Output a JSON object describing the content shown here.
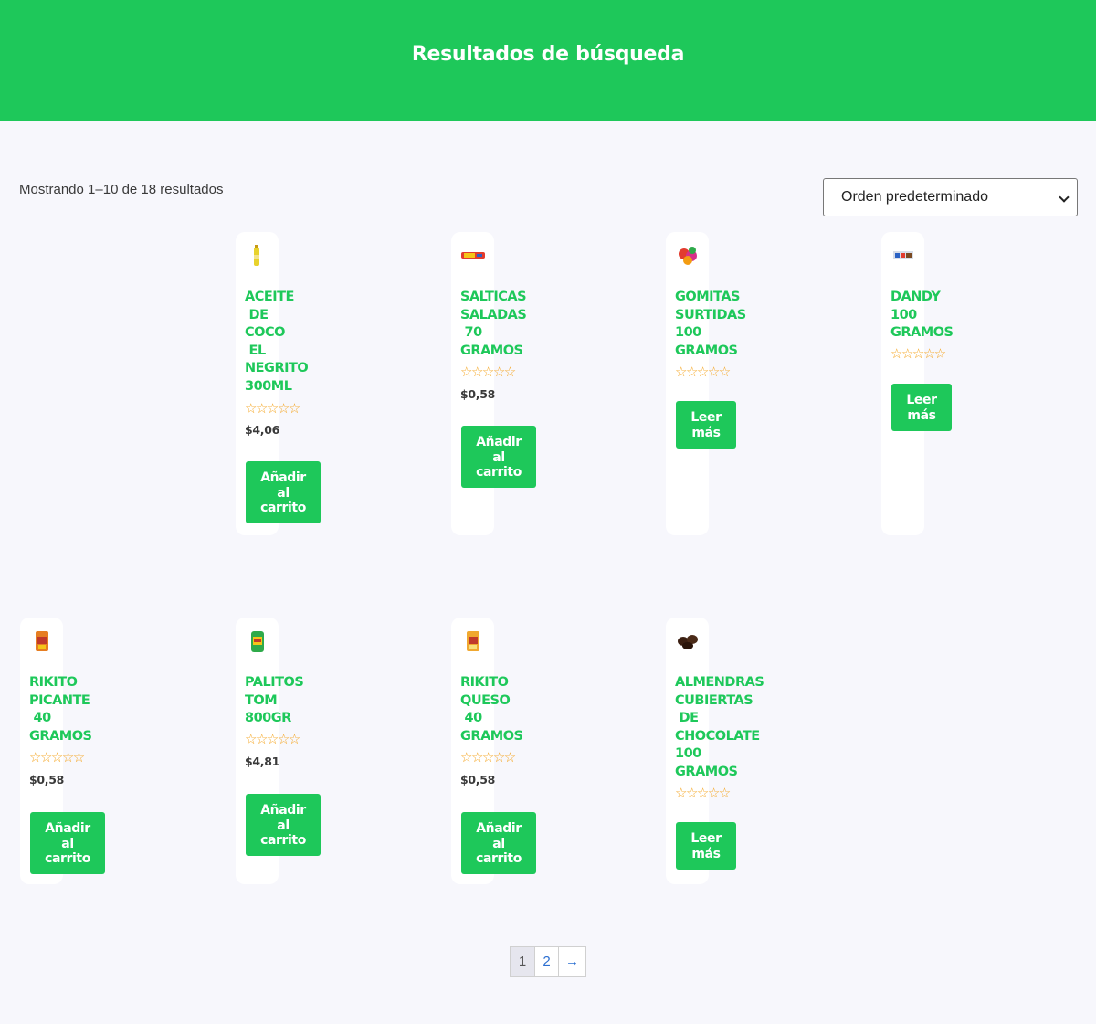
{
  "header": {
    "title": "Resultados de búsqueda"
  },
  "toolbar": {
    "result_count": "Mostrando 1–10 de 18 resultados",
    "orderby_selected": "Orden predeterminado"
  },
  "products": [
    {
      "name": "ACEITE\n DE\nCOCO\n EL\nNEGRITO\n300ML",
      "rating": "☆☆☆☆☆",
      "price": "$4,06",
      "button": "Añadir\nal\ncarrito"
    },
    {
      "name": "SALTICAS\nSALADAS\n 70\nGRAMOS",
      "rating": "☆☆☆☆☆",
      "price": "$0,58",
      "button": "Añadir\nal\ncarrito"
    },
    {
      "name": "GOMITAS\nSURTIDAS\n100\nGRAMOS",
      "rating": "☆☆☆☆☆",
      "button": "Leer\nmás"
    },
    {
      "name": "DANDY\n100\nGRAMOS",
      "rating": "☆☆☆☆☆",
      "button": "Leer\nmás"
    },
    {
      "name": "RIKITO\nPICANTE\n 40\nGRAMOS",
      "rating": "☆☆☆☆☆",
      "price": "$0,58",
      "button": "Añadir\nal\ncarrito"
    },
    {
      "name": "PALITOS\nTOM\n800GR",
      "rating": "☆☆☆☆☆",
      "price": "$4,81",
      "button": "Añadir\nal\ncarrito"
    },
    {
      "name": "RIKITO\nQUESO\n 40\nGRAMOS",
      "rating": "☆☆☆☆☆",
      "price": "$0,58",
      "button": "Añadir\nal\ncarrito"
    },
    {
      "name": "ALMENDRAS\nCUBIERTAS\n DE\nCHOCOLATE\n100\nGRAMOS",
      "rating": "☆☆☆☆☆",
      "button": "Leer\nmás"
    }
  ],
  "pagination": {
    "page1": "1",
    "page2": "2",
    "next": "→"
  },
  "colors": {
    "brand_green": "#1ec85a",
    "star": "#f5a623",
    "background": "#f7f7fc"
  }
}
